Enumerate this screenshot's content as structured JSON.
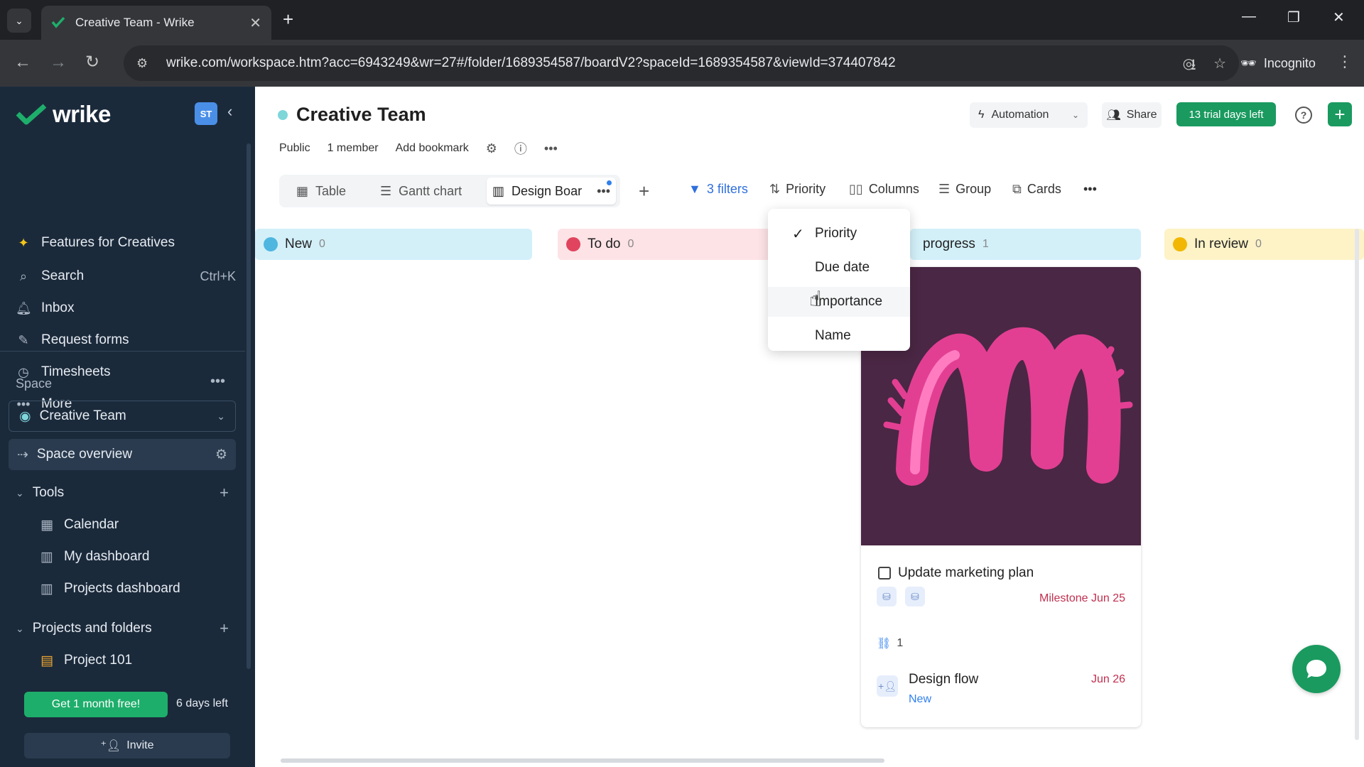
{
  "browser": {
    "tab_title": "Creative Team - Wrike",
    "url": "wrike.com/workspace.htm?acc=6943249&wr=27#/folder/1689354587/boardV2?spaceId=1689354587&viewId=374407842",
    "incognito_label": "Incognito"
  },
  "sidebar": {
    "logo": "wrike",
    "user_initials": "ST",
    "nav": [
      {
        "label": "Features for Creatives",
        "icon": "sparkle-icon"
      },
      {
        "label": "Search",
        "icon": "search-icon",
        "shortcut": "Ctrl+K"
      },
      {
        "label": "Inbox",
        "icon": "bell-icon"
      },
      {
        "label": "Request forms",
        "icon": "form-icon"
      },
      {
        "label": "Timesheets",
        "icon": "clock-icon"
      },
      {
        "label": "More",
        "icon": "more-icon"
      }
    ],
    "space_label": "Space",
    "space_name": "Creative Team",
    "space_overview": "Space overview",
    "tools_label": "Tools",
    "tools": [
      {
        "label": "Calendar",
        "icon": "calendar-icon"
      },
      {
        "label": "My dashboard",
        "icon": "dashboard-icon"
      },
      {
        "label": "Projects dashboard",
        "icon": "dashboard-icon"
      }
    ],
    "projects_label": "Projects and folders",
    "projects": [
      {
        "label": "Project 101",
        "icon": "project-icon"
      }
    ],
    "promo_button": "Get 1 month free!",
    "days_left": "6 days left",
    "invite": "Invite"
  },
  "header": {
    "title": "Creative Team",
    "visibility": "Public",
    "members": "1 member",
    "bookmark": "Add bookmark",
    "automation": "Automation",
    "share": "Share",
    "trial": "13 trial days left"
  },
  "views": {
    "tabs": [
      {
        "label": "Table",
        "icon": "table-icon"
      },
      {
        "label": "Gantt chart",
        "icon": "gantt-icon"
      },
      {
        "label": "Design Boar",
        "icon": "board-icon",
        "active": true
      }
    ],
    "toolbar": {
      "filters": "3 filters",
      "sort": "Priority",
      "columns": "Columns",
      "group": "Group",
      "cards": "Cards"
    }
  },
  "board": {
    "columns": [
      {
        "name": "New",
        "count": "0",
        "color": "#d3f0f9",
        "icon_color": "#4fb6e0"
      },
      {
        "name": "To do",
        "count": "0",
        "color": "#fde3e6",
        "icon_color": "#e0445e"
      },
      {
        "name": "progress",
        "count": "1",
        "color": "#d3f0f9",
        "icon_color": "#4fb6e0"
      },
      {
        "name": "In review",
        "count": "0",
        "color": "#fdf3c7",
        "icon_color": "#f2b705"
      }
    ],
    "card": {
      "title": "Update marketing plan",
      "milestone": "Milestone Jun 25",
      "subtask_count": "1",
      "subtask_title": "Design flow",
      "subtask_status": "New",
      "subtask_date": "Jun 26"
    }
  },
  "sort_menu": {
    "items": [
      "Priority",
      "Due date",
      "Importance",
      "Name"
    ],
    "selected": "Priority",
    "hovered": "Importance"
  }
}
